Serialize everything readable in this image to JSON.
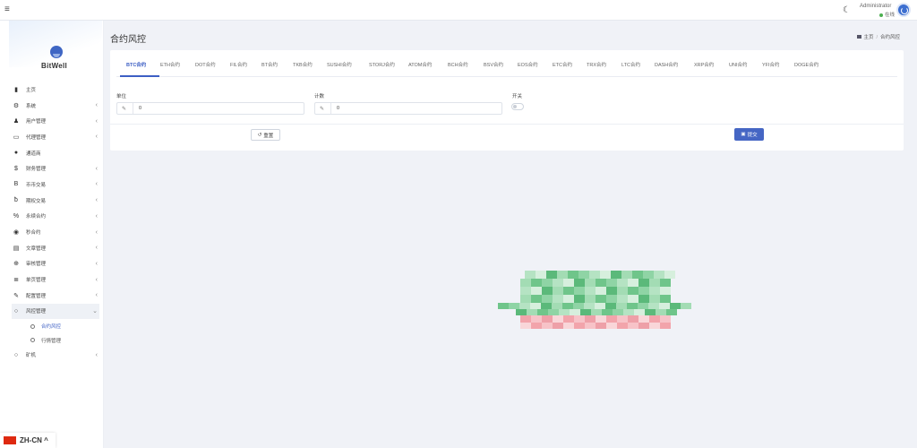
{
  "topbar": {
    "user_name": "Administrator",
    "user_status": "在线"
  },
  "sidebar": {
    "brand": "BitWell",
    "items": [
      {
        "label": "主页",
        "icon": "chart-icon",
        "chevron": false
      },
      {
        "label": "系统",
        "icon": "gear-icon",
        "chevron": true
      },
      {
        "label": "用户管理",
        "icon": "users-icon",
        "chevron": true
      },
      {
        "label": "代理管理",
        "icon": "id-card-icon",
        "chevron": true
      },
      {
        "label": "通道商",
        "icon": "user-icon",
        "chevron": false
      },
      {
        "label": "财务管理",
        "icon": "dollar-icon",
        "chevron": true
      },
      {
        "label": "币币交易",
        "icon": "bitcoin-icon",
        "chevron": true
      },
      {
        "label": "期权交易",
        "icon": "bitcoin-small-icon",
        "chevron": true
      },
      {
        "label": "永续合约",
        "icon": "link-icon",
        "chevron": true
      },
      {
        "label": "秒合约",
        "icon": "circle-dot-icon",
        "chevron": true
      },
      {
        "label": "文章管理",
        "icon": "newspaper-icon",
        "chevron": true
      },
      {
        "label": "审核管理",
        "icon": "lifebuoy-icon",
        "chevron": true
      },
      {
        "label": "单页管理",
        "icon": "list-icon",
        "chevron": true
      },
      {
        "label": "配置管理",
        "icon": "wrench-icon",
        "chevron": true
      },
      {
        "label": "风控管理",
        "icon": "circle-icon",
        "chevron": true,
        "expanded": true
      }
    ],
    "sub_items": [
      {
        "label": "合约风控",
        "active": true
      },
      {
        "label": "行情管理",
        "active": false
      }
    ],
    "last_item": {
      "label": "矿机",
      "icon": "circle-icon",
      "chevron": true
    }
  },
  "language": {
    "label": "ZH-CN"
  },
  "page": {
    "title": "合约风控",
    "breadcrumb_home": "主页",
    "breadcrumb_current": "合约风控"
  },
  "tabs": [
    "BTC合约",
    "ETH合约",
    "DOT合约",
    "FIL合约",
    "BT合约",
    "TKB合约",
    "SUSHI合约",
    "STORJ合约",
    "ATOM合约",
    "BCH合约",
    "BSV合约",
    "EOS合约",
    "ETC合约",
    "TRX合约",
    "LTC合约",
    "DASH合约",
    "XRP合约",
    "UNI合约",
    "YFI合约",
    "DOGE合约"
  ],
  "active_tab": "BTC合约",
  "form": {
    "unit_label": "单位",
    "unit_value": "0",
    "count_label": "计数",
    "count_value": "0",
    "switch_label": "开关",
    "switch_on": false,
    "reset_label": "重置",
    "submit_label": "提交"
  },
  "colors": {
    "accent": "#3d5fc4",
    "submit": "#4566c4",
    "status_online": "#4caf50"
  }
}
